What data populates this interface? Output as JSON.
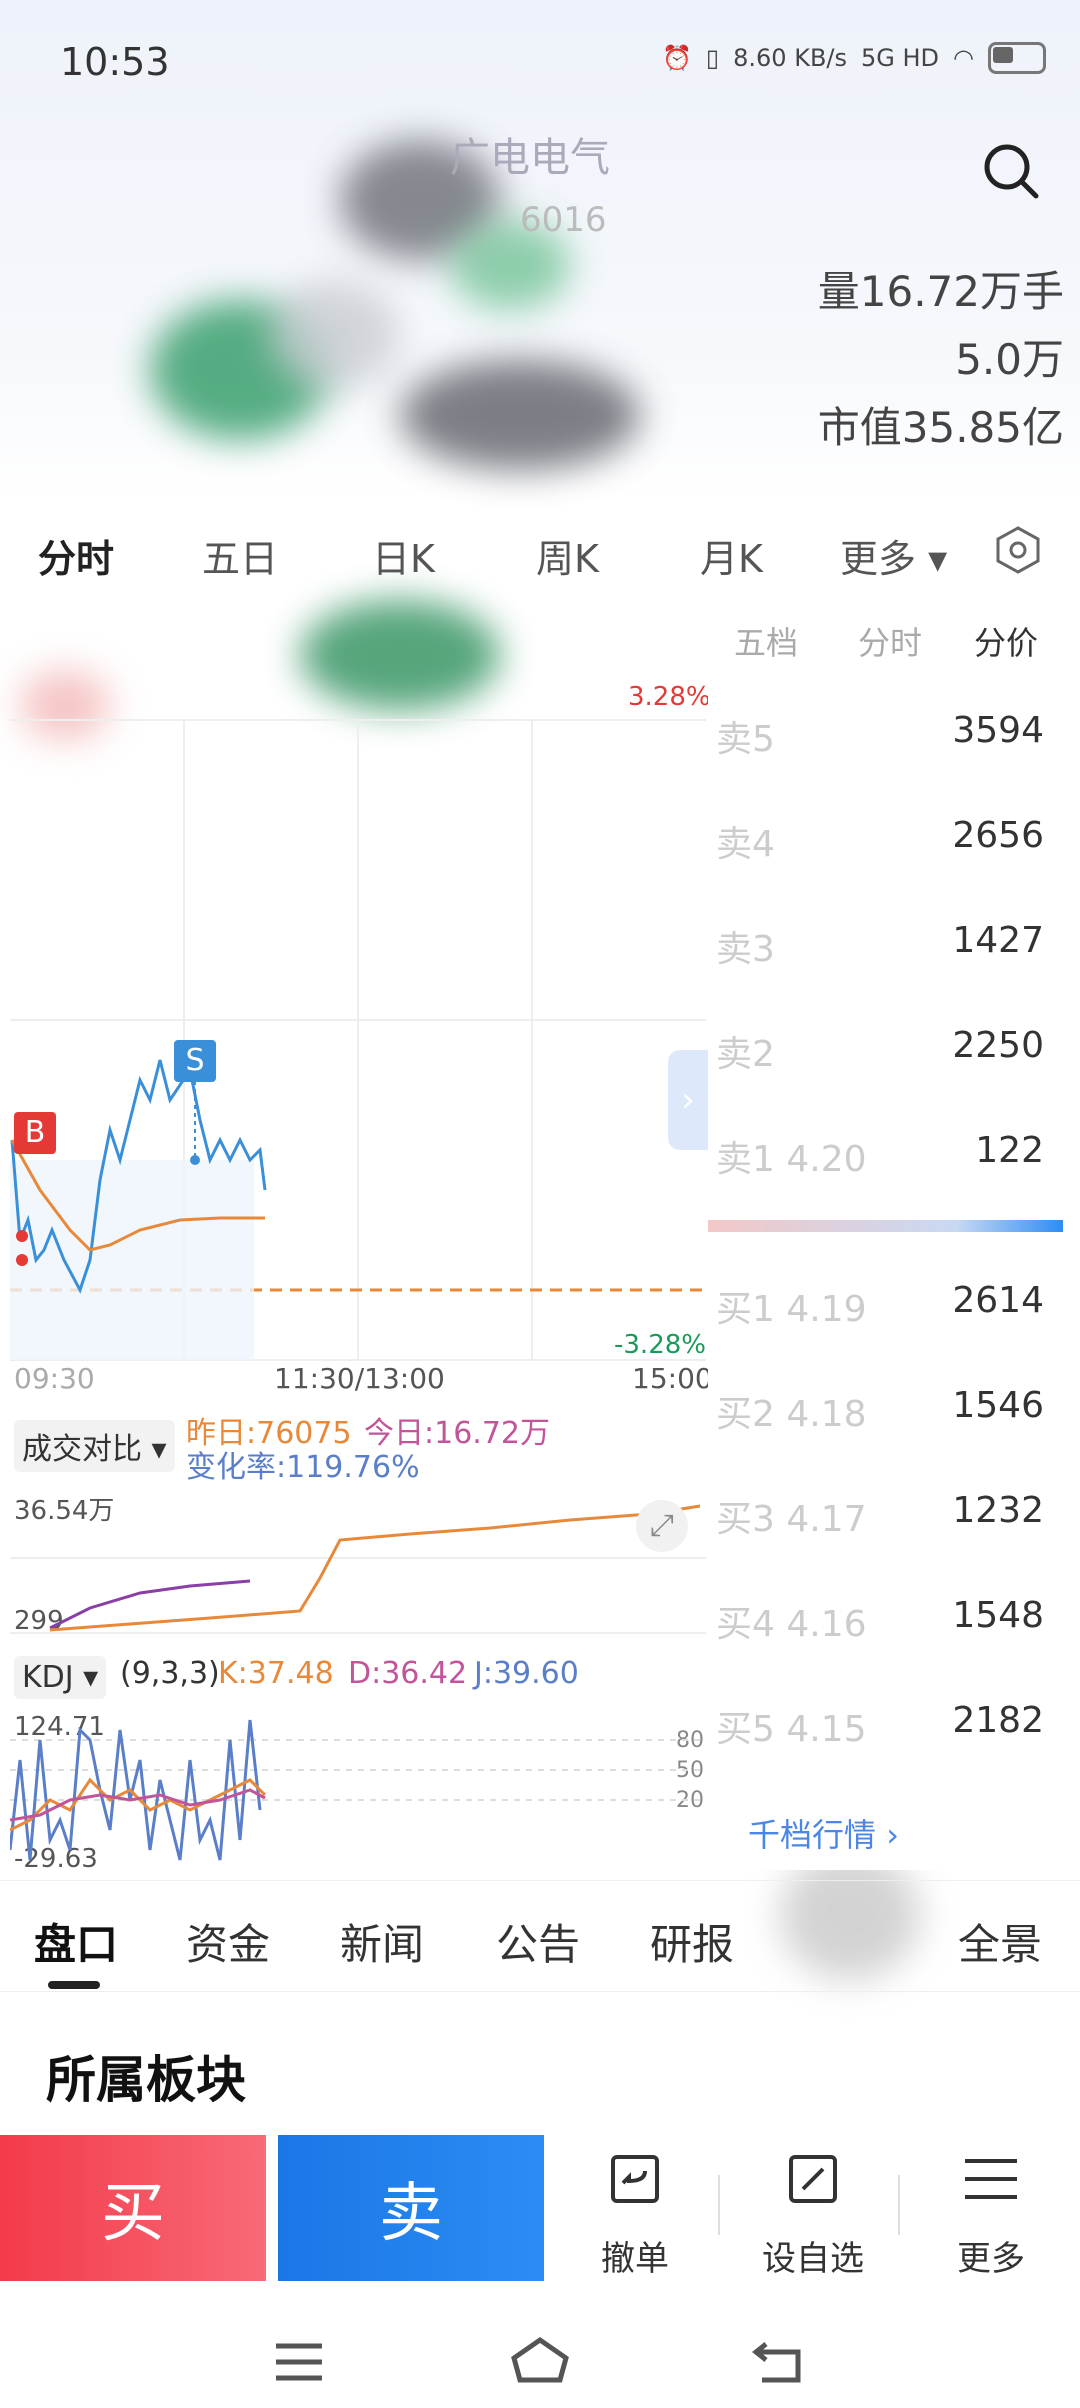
{
  "status_bar": {
    "time": "10:53",
    "net_speed": "8.60",
    "net_unit": "KB/s",
    "network": "5G HD"
  },
  "header": {
    "stock_name": "广电电气",
    "stock_code": "6016",
    "stat_volume": "量16.72万手",
    "stat_amount": "5.0万",
    "stat_marketcap": "市值35.85亿",
    "stat_circ": "35.85亿"
  },
  "chart_tabs": [
    "分时",
    "五日",
    "日K",
    "周K",
    "月K",
    "更多"
  ],
  "chart": {
    "pct_top": "3.28%",
    "pct_bottom": "-3.28%",
    "time_start": "09:30",
    "time_mid": "11:30/13:00",
    "time_end": "15:00",
    "marker_buy": "B",
    "marker_sell": "S"
  },
  "volume_compare": {
    "label": "成交对比",
    "yesterday": "昨日:76075",
    "today": "今日:16.72万",
    "change": "变化率:119.76%",
    "y_max": "36.54万",
    "y_min": "299"
  },
  "kdj": {
    "label": "KDJ",
    "params": "(9,3,3)",
    "k": "K:37.48",
    "d": "D:36.42",
    "j": "J:39.60",
    "y_max": "124.71",
    "y_min": "-29.63",
    "lvl80": "80",
    "lvl50": "50",
    "lvl20": "20"
  },
  "order_panel": {
    "tabs": [
      "五档",
      "分时",
      "分价"
    ],
    "sell_rows": [
      {
        "label": "卖5",
        "volume": "3594"
      },
      {
        "label": "卖4",
        "volume": "2656"
      },
      {
        "label": "卖3",
        "volume": "1427"
      },
      {
        "label": "卖2",
        "volume": "2250"
      },
      {
        "label": "卖1 4.20",
        "volume": "122"
      }
    ],
    "buy_rows": [
      {
        "label": "买1 4.19",
        "volume": "2614"
      },
      {
        "label": "买2 4.18",
        "volume": "1546"
      },
      {
        "label": "买3 4.17",
        "volume": "1232"
      },
      {
        "label": "买4 4.16",
        "volume": "1548"
      },
      {
        "label": "买5 4.15",
        "volume": "2182"
      }
    ],
    "more_link": "千档行情"
  },
  "bottom_tabs": [
    "盘口",
    "资金",
    "新闻",
    "公告",
    "研报",
    "全景"
  ],
  "section_title": "所属板块",
  "trade_bar": {
    "buy": "买",
    "sell": "卖",
    "cancel": "撤单",
    "watchlist": "设自选",
    "more": "更多"
  },
  "colors": {
    "up": "#f33a4a",
    "down": "#1a9a5a",
    "accent": "#2d8cf4",
    "avg_line": "#e8893a",
    "price_line": "#3a8fd9"
  }
}
